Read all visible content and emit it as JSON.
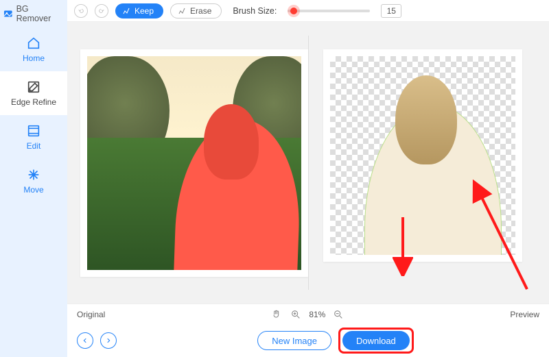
{
  "brand": {
    "title": "BG Remover"
  },
  "sidebar": {
    "items": [
      {
        "label": "Home"
      },
      {
        "label": "Edge Refine"
      },
      {
        "label": "Edit"
      },
      {
        "label": "Move"
      }
    ]
  },
  "toolbar": {
    "keep_label": "Keep",
    "erase_label": "Erase",
    "brush_label": "Brush Size:",
    "brush_value": "15"
  },
  "status": {
    "original_label": "Original",
    "zoom_value": "81%",
    "preview_label": "Preview"
  },
  "bottom": {
    "new_image_label": "New Image",
    "download_label": "Download"
  }
}
